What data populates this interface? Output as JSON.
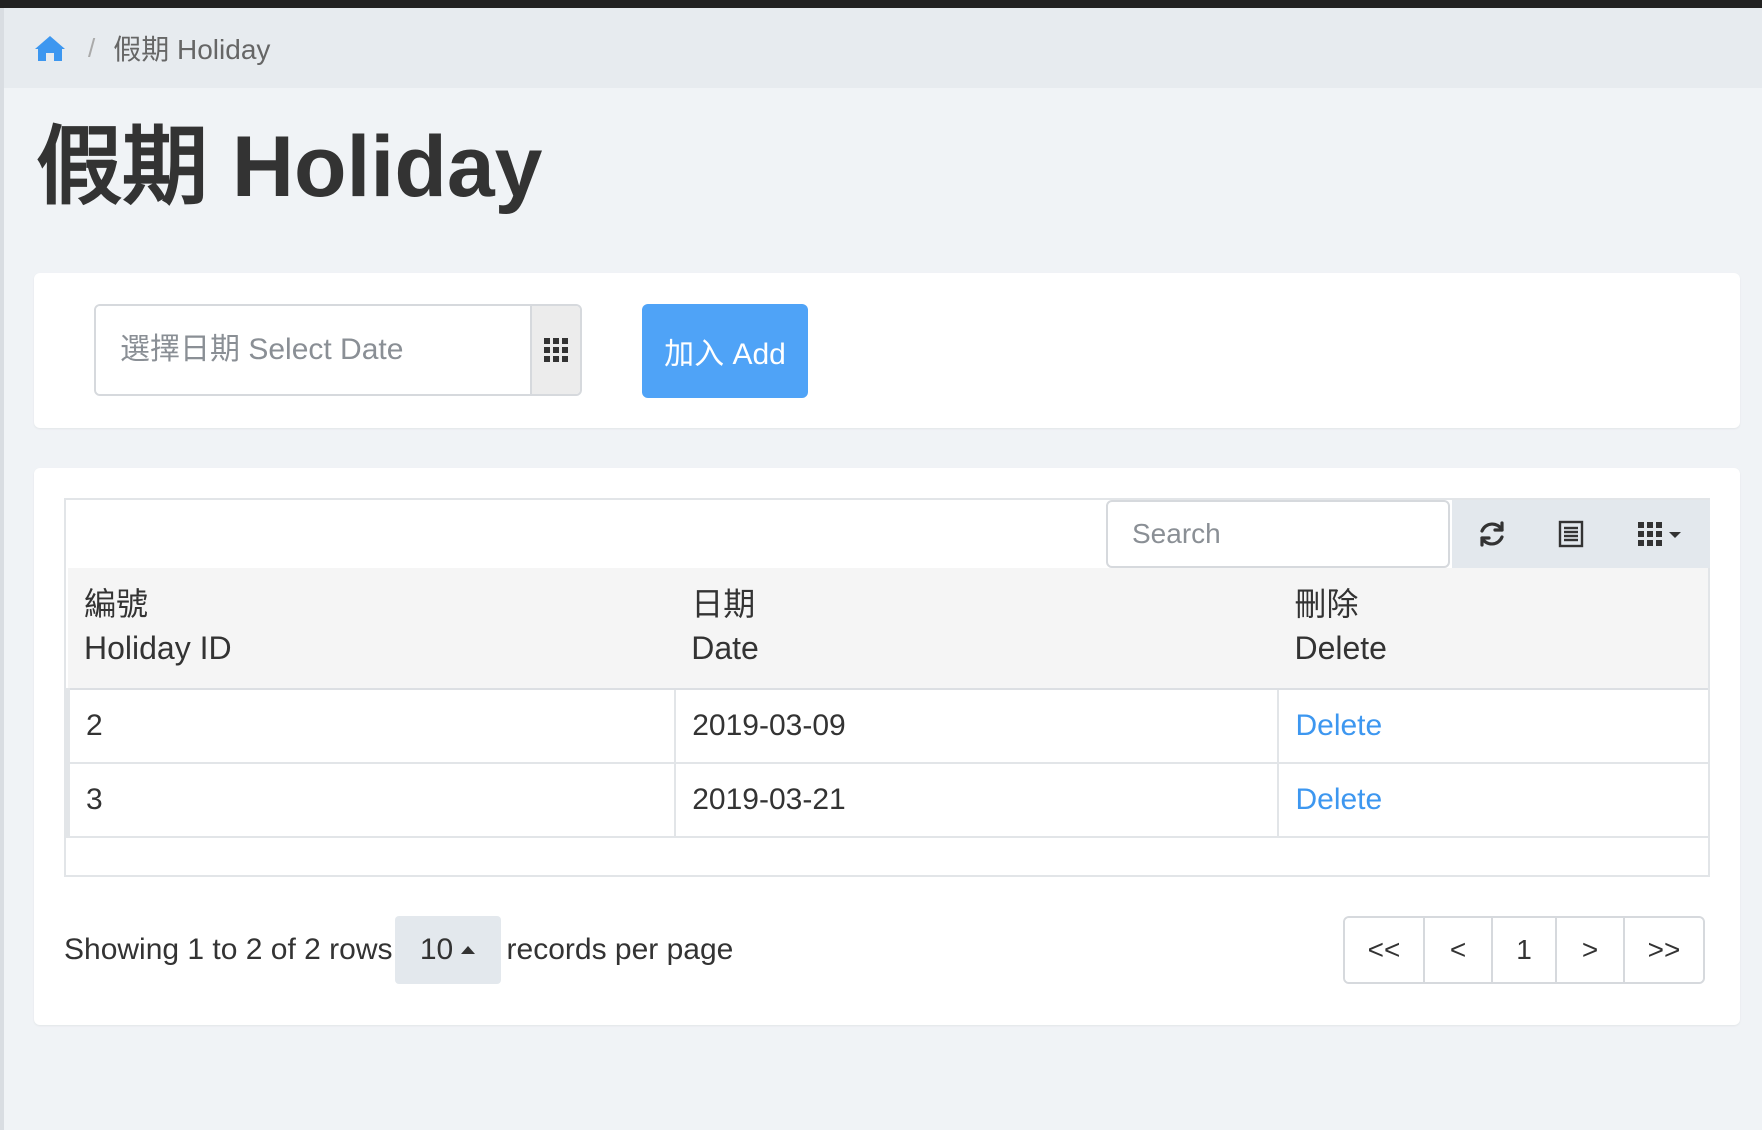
{
  "breadcrumb": {
    "current": "假期 Holiday"
  },
  "page": {
    "title": "假期 Holiday"
  },
  "add_form": {
    "date_placeholder": "選擇日期 Select Date",
    "add_label": "加入 Add"
  },
  "table": {
    "search_placeholder": "Search",
    "columns": [
      {
        "zh": "編號",
        "en": "Holiday ID"
      },
      {
        "zh": "日期",
        "en": "Date"
      },
      {
        "zh": "刪除",
        "en": "Delete"
      }
    ],
    "rows": [
      {
        "id": "2",
        "date": "2019-03-09",
        "action": "Delete"
      },
      {
        "id": "3",
        "date": "2019-03-21",
        "action": "Delete"
      }
    ]
  },
  "footer": {
    "showing": "Showing 1 to 2 of 2 rows",
    "page_size": "10",
    "records_per_page": "records per page"
  },
  "pagination": {
    "first": "<<",
    "prev": "<",
    "current": "1",
    "next": ">",
    "last": ">>"
  },
  "colors": {
    "accent": "#4fa3f7",
    "link": "#3d97f0",
    "background": "#f0f3f6"
  }
}
